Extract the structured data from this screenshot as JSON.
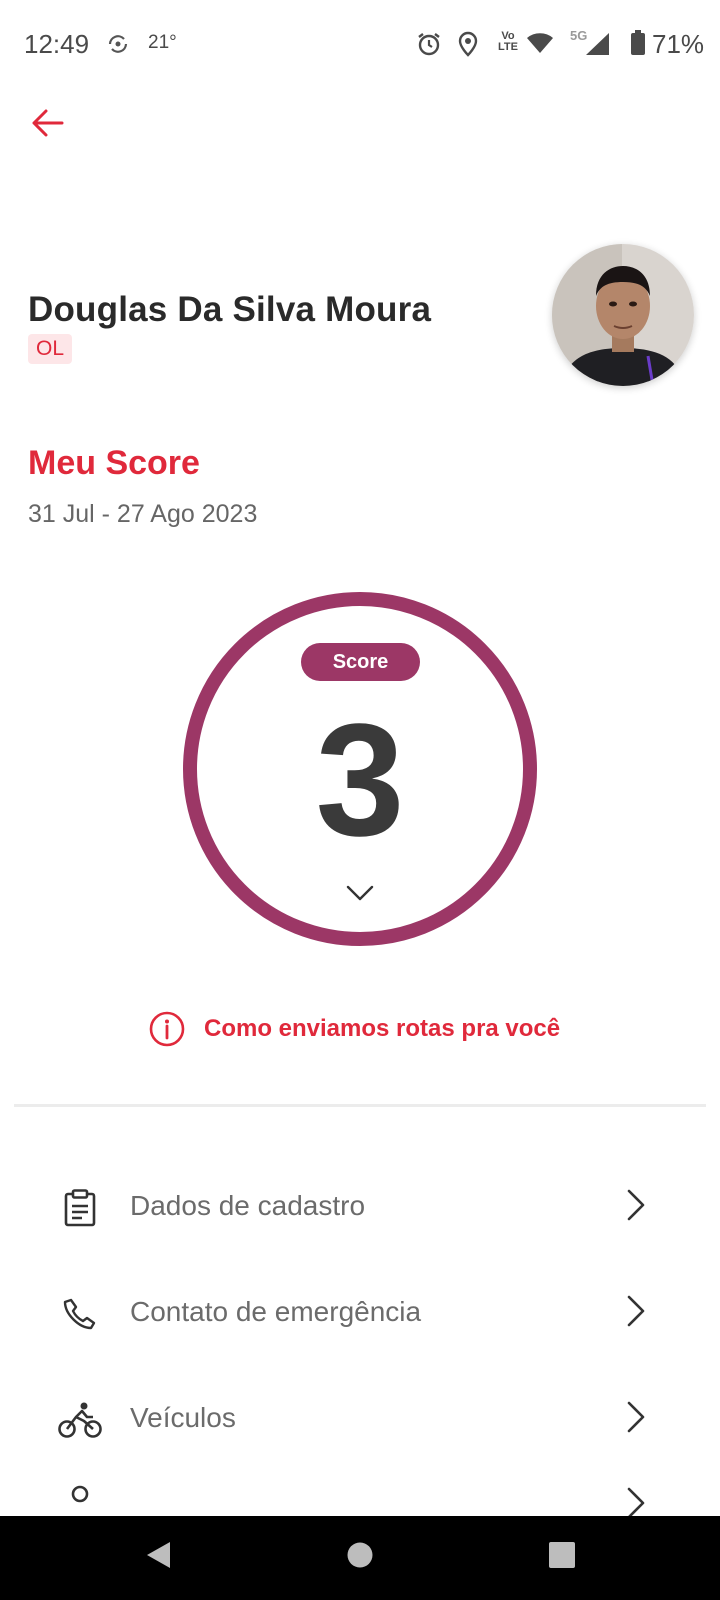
{
  "status_bar": {
    "time": "12:49",
    "temperature": "21°",
    "network": "5G",
    "volte": "Vo LTE",
    "battery": "71%"
  },
  "header": {
    "back_icon": "arrow-left-icon"
  },
  "profile": {
    "name": "Douglas Da Silva Moura",
    "role_badge": "OL",
    "avatar_icon": "avatar"
  },
  "score": {
    "title": "Meu Score",
    "period": "31 Jul - 27 Ago 2023",
    "label": "Score",
    "value": "3",
    "info_link": "Como enviamos rotas pra você"
  },
  "menu": {
    "items": [
      {
        "label": "Dados de cadastro",
        "icon": "clipboard-icon"
      },
      {
        "label": "Contato de emergência",
        "icon": "phone-icon"
      },
      {
        "label": "Veículos",
        "icon": "bicycle-icon"
      },
      {
        "label": "",
        "icon": "person-icon"
      }
    ]
  },
  "colors": {
    "accent": "#e0293b",
    "score_ring": "#9c3766",
    "badge_bg": "#fde6e8"
  }
}
